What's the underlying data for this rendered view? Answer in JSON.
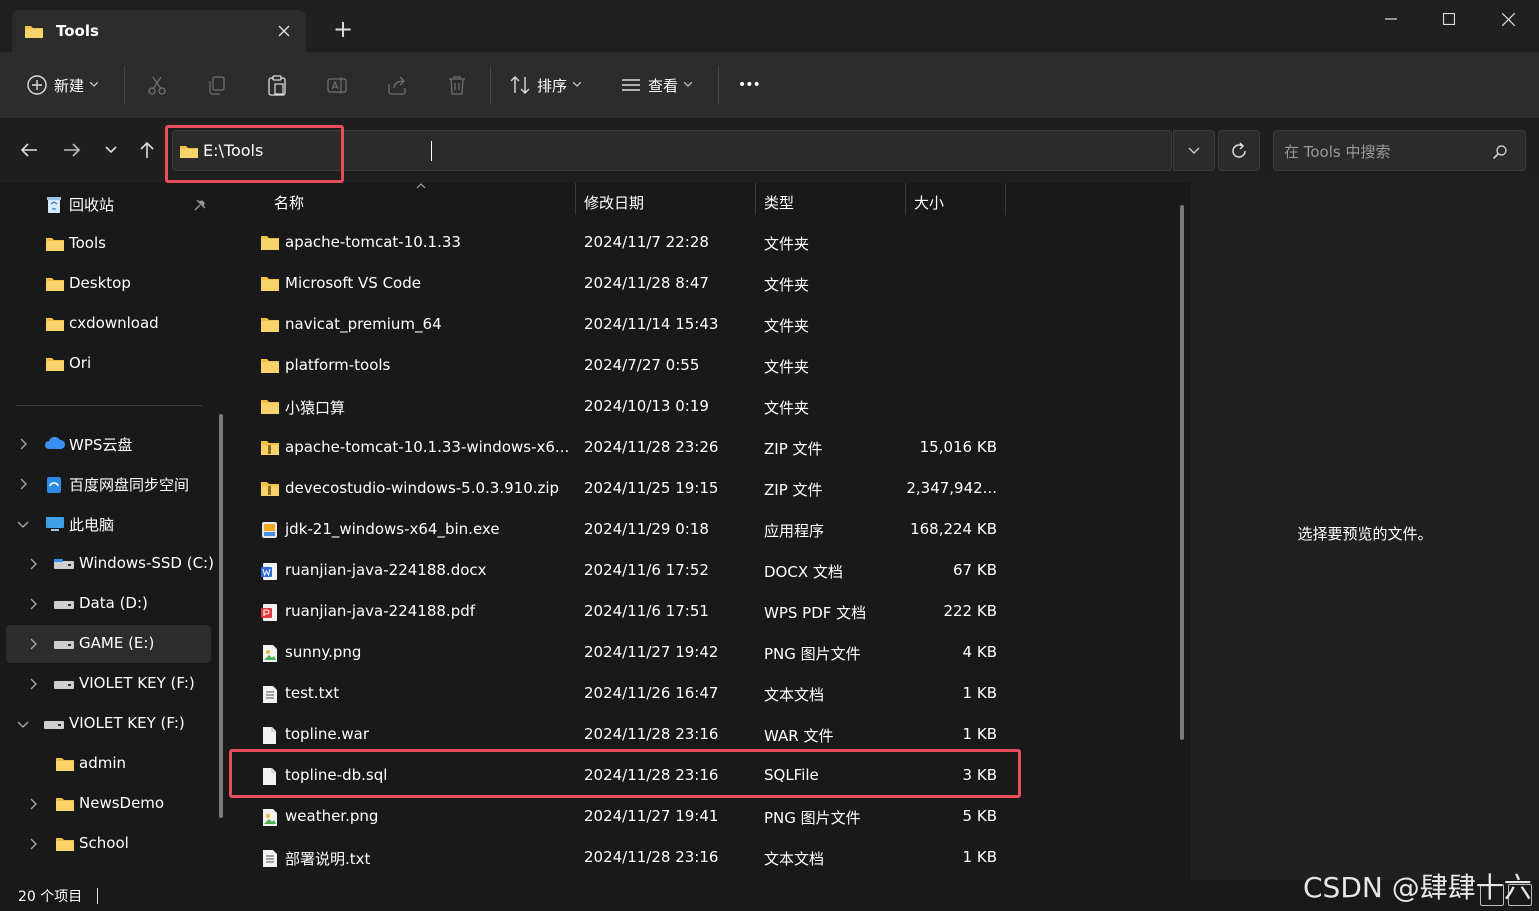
{
  "window": {
    "tab_title": "Tools",
    "new_tab": "+",
    "minimize": "—",
    "maximize": "☐",
    "close": "✕"
  },
  "toolbar": {
    "new_label": "新建",
    "sort_label": "排序",
    "view_label": "查看",
    "more_label": "•••"
  },
  "address": {
    "path": "E:\\Tools",
    "search_placeholder": "在 Tools 中搜索"
  },
  "sidebar": {
    "pinned": [
      {
        "label": "回收站",
        "icon": "recycle-bin-icon"
      },
      {
        "label": "Tools",
        "icon": "folder-icon"
      },
      {
        "label": "Desktop",
        "icon": "folder-icon"
      },
      {
        "label": "cxdownload",
        "icon": "folder-icon"
      },
      {
        "label": "Ori",
        "icon": "folder-icon"
      }
    ],
    "tree": [
      {
        "label": "WPS云盘",
        "icon": "cloud-icon"
      },
      {
        "label": "百度网盘同步空间",
        "icon": "baidu-netdisk-icon"
      },
      {
        "label": "此电脑",
        "icon": "computer-icon"
      },
      {
        "label": "Windows-SSD (C:)",
        "icon": "drive-icon"
      },
      {
        "label": "Data (D:)",
        "icon": "drive-icon"
      },
      {
        "label": "GAME (E:)",
        "icon": "drive-icon"
      },
      {
        "label": "VIOLET KEY (F:)",
        "icon": "drive-icon"
      },
      {
        "label": "VIOLET KEY (F:)",
        "icon": "drive-icon"
      },
      {
        "label": "admin",
        "icon": "folder-icon"
      },
      {
        "label": "NewsDemo",
        "icon": "folder-icon"
      },
      {
        "label": "School",
        "icon": "folder-icon"
      }
    ]
  },
  "columns": {
    "name": "名称",
    "date": "修改日期",
    "type": "类型",
    "size": "大小"
  },
  "files": [
    {
      "name": "apache-tomcat-10.1.33",
      "date": "2024/11/7 22:28",
      "type": "文件夹",
      "size": "",
      "icon": "folder-icon"
    },
    {
      "name": "Microsoft VS Code",
      "date": "2024/11/28 8:47",
      "type": "文件夹",
      "size": "",
      "icon": "folder-icon"
    },
    {
      "name": "navicat_premium_64",
      "date": "2024/11/14 15:43",
      "type": "文件夹",
      "size": "",
      "icon": "folder-icon"
    },
    {
      "name": "platform-tools",
      "date": "2024/7/27 0:55",
      "type": "文件夹",
      "size": "",
      "icon": "folder-icon"
    },
    {
      "name": "小猿口算",
      "date": "2024/10/13 0:19",
      "type": "文件夹",
      "size": "",
      "icon": "folder-icon"
    },
    {
      "name": "apache-tomcat-10.1.33-windows-x6...",
      "date": "2024/11/28 23:26",
      "type": "ZIP 文件",
      "size": "15,016 KB",
      "icon": "zip-icon"
    },
    {
      "name": "devecostudio-windows-5.0.3.910.zip",
      "date": "2024/11/25 19:15",
      "type": "ZIP 文件",
      "size": "2,347,942...",
      "icon": "zip-icon"
    },
    {
      "name": "jdk-21_windows-x64_bin.exe",
      "date": "2024/11/29 0:18",
      "type": "应用程序",
      "size": "168,224 KB",
      "icon": "installer-icon"
    },
    {
      "name": "ruanjian-java-224188.docx",
      "date": "2024/11/6 17:52",
      "type": "DOCX 文档",
      "size": "67 KB",
      "icon": "word-doc-icon"
    },
    {
      "name": "ruanjian-java-224188.pdf",
      "date": "2024/11/6 17:51",
      "type": "WPS PDF 文档",
      "size": "222 KB",
      "icon": "pdf-icon"
    },
    {
      "name": "sunny.png",
      "date": "2024/11/27 19:42",
      "type": "PNG 图片文件",
      "size": "4 KB",
      "icon": "image-file-icon"
    },
    {
      "name": "test.txt",
      "date": "2024/11/26 16:47",
      "type": "文本文档",
      "size": "1 KB",
      "icon": "text-file-icon"
    },
    {
      "name": "topline.war",
      "date": "2024/11/28 23:16",
      "type": "WAR 文件",
      "size": "1 KB",
      "icon": "blank-file-icon"
    },
    {
      "name": "topline-db.sql",
      "date": "2024/11/28 23:16",
      "type": "SQLFile",
      "size": "3 KB",
      "icon": "blank-file-icon"
    },
    {
      "name": "weather.png",
      "date": "2024/11/27 19:41",
      "type": "PNG 图片文件",
      "size": "5 KB",
      "icon": "image-file-icon"
    },
    {
      "name": "部署说明.txt",
      "date": "2024/11/28 23:16",
      "type": "文本文档",
      "size": "1 KB",
      "icon": "text-file-icon"
    }
  ],
  "preview": {
    "message": "选择要预览的文件。"
  },
  "status": {
    "item_count": "20 个项目"
  },
  "watermark": "CSDN @肆肆十六",
  "colors": {
    "accent_highlight": "#e84d5d",
    "folder": "#f2c046",
    "background": "#191919"
  }
}
